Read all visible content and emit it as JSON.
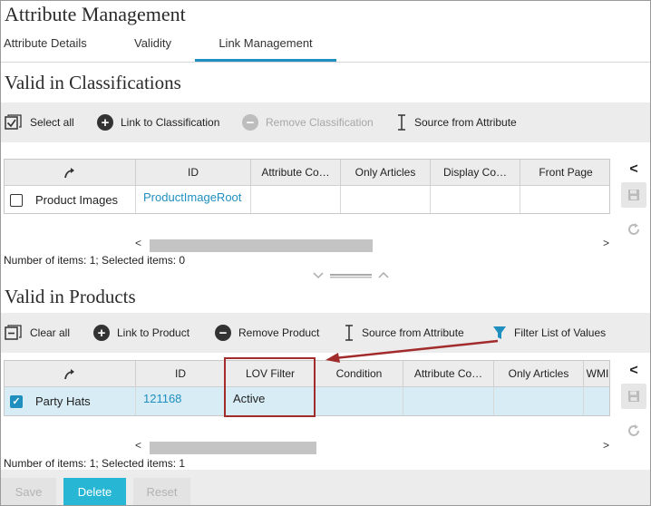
{
  "page": {
    "title": "Attribute Management",
    "tabs": [
      {
        "label": "Attribute Details"
      },
      {
        "label": "Validity"
      },
      {
        "label": "Link Management"
      }
    ]
  },
  "classifications": {
    "title": "Valid in Classifications",
    "toolbar": {
      "select_all": "Select all",
      "link": "Link to Classification",
      "remove": "Remove Classification",
      "source": "Source from Attribute"
    },
    "columns": [
      "ID",
      "Attribute Co…",
      "Only Articles",
      "Display Co…",
      "Front Page"
    ],
    "row": {
      "name": "Product Images",
      "id": "ProductImageRoot",
      "checked": false
    },
    "status": "Number of items: 1; Selected items: 0"
  },
  "products": {
    "title": "Valid in Products",
    "toolbar": {
      "clear_all": "Clear all",
      "link": "Link to Product",
      "remove": "Remove Product",
      "source": "Source from Attribute",
      "filter": "Filter List of Values"
    },
    "columns": [
      "ID",
      "LOV Filter",
      "Condition",
      "Attribute Co…",
      "Only Articles",
      "WMI"
    ],
    "row": {
      "name": "Party Hats",
      "id": "121168",
      "lov_filter": "Active",
      "checked": true
    },
    "status": "Number of items: 1; Selected items: 1"
  },
  "footer": {
    "save": "Save",
    "delete": "Delete",
    "reset": "Reset"
  },
  "colors": {
    "accent": "#1f8fbf",
    "primary_button": "#27b6d4",
    "callout": "#a22b2b",
    "filter_icon": "#1f8fbf"
  },
  "icons": {
    "select_all": "select-all-icon",
    "link": "plus-circle-icon",
    "remove": "minus-circle-icon",
    "source": "text-cursor-icon",
    "filter": "funnel-icon",
    "clear_all": "clear-all-icon",
    "link_column": "link-arrow-icon",
    "collapse": "chevron-left-icon",
    "save": "floppy-disk-icon",
    "refresh": "refresh-icon"
  }
}
